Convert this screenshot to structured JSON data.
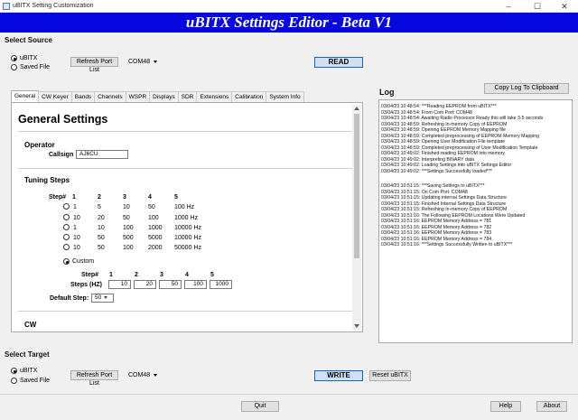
{
  "window": {
    "title": "uBITX Setting Customization"
  },
  "banner": {
    "text": "uBITX Settings Editor - Beta V1"
  },
  "source": {
    "title": "Select Source",
    "options": [
      "uBITX",
      "Saved File"
    ],
    "refresh_label": "Refresh Port List",
    "port": "COM48",
    "read_label": "READ"
  },
  "tabs": [
    "General",
    "CW Keyer",
    "Bands",
    "Channels",
    "WSPR",
    "Displays",
    "SDR",
    "Extensions",
    "Calibration",
    "System Info"
  ],
  "general": {
    "heading": "General Settings",
    "operator": {
      "heading": "Operator",
      "callsign_label": "Callsign",
      "callsign": "AJ6CU"
    },
    "tuning": {
      "heading": "Tuning Steps",
      "step_label": "Step#",
      "step_numbers": [
        "1",
        "2",
        "3",
        "4",
        "5"
      ],
      "presets": [
        [
          "1",
          "5",
          "10",
          "50",
          "100 Hz"
        ],
        [
          "10",
          "20",
          "50",
          "100",
          "1000 Hz"
        ],
        [
          "1",
          "10",
          "100",
          "1000",
          "10000 Hz"
        ],
        [
          "10",
          "50",
          "500",
          "5000",
          "10000 Hz"
        ],
        [
          "10",
          "50",
          "100",
          "2000",
          "50000 Hz"
        ]
      ],
      "custom_label": "Custom",
      "custom_step_label": "Step#",
      "steps_hz_label": "Steps (HZ)",
      "custom_values": [
        "10",
        "20",
        "50",
        "100",
        "1000"
      ],
      "default_step_label": "Default Step:",
      "default_step": "50"
    },
    "cw_heading": "CW"
  },
  "log": {
    "title": "Log",
    "copy_label": "Copy Log To Clipboard",
    "lines": [
      "03/04/23 10:48:54: ***Reading EEPROM from uBITX***",
      "03/04/23 10:48:54: From Com Port: COM48",
      "03/04/23 10:48:54: Awaiting Radio Processor Ready this will take 3-5 seconds",
      "03/04/23 10:48:59: Refreshing In-memory Copy of EEPROM",
      "03/04/23 10:48:59: Opening EEPROM Memory Mapping file",
      "03/04/23 10:48:59: Completed preprocessing of EEPROM Memory Mapping",
      "03/04/23 10:48:59: Opening User Modification File template",
      "03/04/23 10:48:59: Completed preprocessing of User Modification Template",
      "03/04/23 10:49:02: Finished reading EEPROM into memory",
      "03/04/23 10:49:02: Interpreting BINARY data",
      "03/04/23 10:49:02: Loading Settings into uBITX Settings Editor",
      "03/04/23 10:49:02: ***Settings Successfully loaded***",
      "",
      "03/04/23 10:51:15: ***Saving Settings to uBITX***",
      "03/04/23 10:51:15: On Com Port: COM48",
      "03/04/23 10:51:15: Updating internal Settings Data Structure",
      "03/04/23 10:51:15: Finished Internal Settings Data Structure",
      "03/04/23 10:51:15: Refreshing In-memory Copy of EEPROM",
      "03/04/23 10:51:16: The Following EEPROM Locations Were Updated",
      "03/04/23 10:51:16: EEPROM Memory Address = 781",
      "03/04/23 10:51:16: EEPROM Memory Address = 782",
      "03/04/23 10:51:16: EEPROM Memory Address = 783",
      "03/04/23 10:51:16: EEPROM Memory Address = 784",
      "03/04/23 10:51:16: ***Settings Successfully Written to uBITX***"
    ]
  },
  "target": {
    "title": "Select Target",
    "options": [
      "uBITX",
      "Saved File"
    ],
    "refresh_label": "Refresh Port List",
    "port": "COM48",
    "write_label": "WRITE",
    "reset_label": "Reset uBITX"
  },
  "footer": {
    "quit_label": "Quit",
    "help_label": "Help",
    "about_label": "About"
  }
}
